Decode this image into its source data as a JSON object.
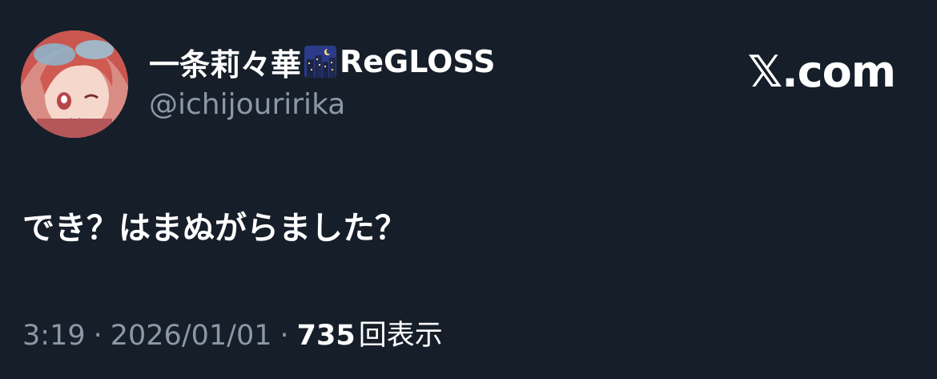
{
  "author": {
    "display_name": "一条莉々華",
    "name_emoji": "night-city-icon",
    "name_suffix": "ReGLOSS",
    "handle": "@ichijouririka"
  },
  "brand": {
    "icon": "x-logo-icon",
    "label": "𝕏.com"
  },
  "tweet": {
    "text": "でき？はまぬがらました？"
  },
  "meta": {
    "time": "3:19",
    "separator": "·",
    "date": "2026/01/01",
    "views_count": "735",
    "views_label": "回表示"
  },
  "colors": {
    "background": "#161e29",
    "primary_text": "#ffffff",
    "secondary_text": "#8b98a5"
  }
}
